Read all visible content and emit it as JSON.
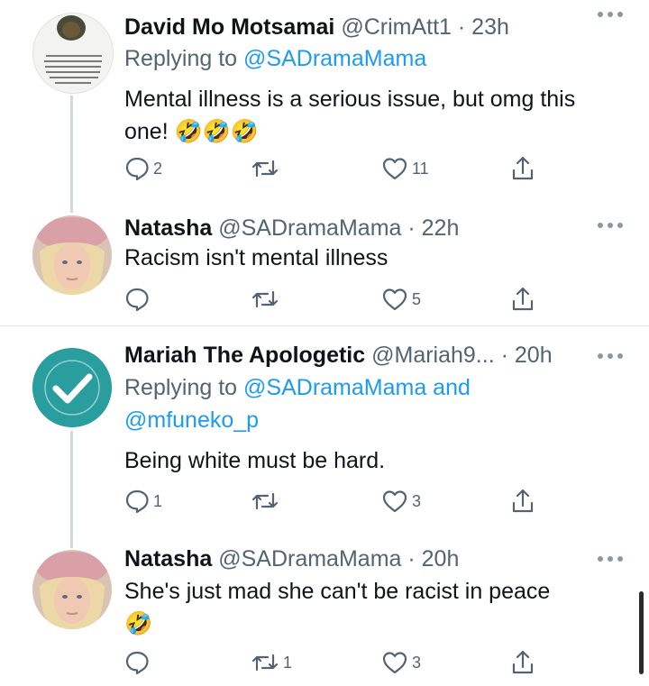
{
  "tweets": [
    {
      "name": "David Mo Motsamai",
      "handle": "@CrimAtt1",
      "dot": "·",
      "time": "23h",
      "reply_prefix": "Replying to ",
      "reply_to": "@SADramaMama",
      "reply_and": "",
      "reply_to2": "",
      "text": "Mental illness is a serious issue, but omg this one! 🤣🤣🤣",
      "reply_count": "2",
      "retweet_count": "",
      "like_count": "11",
      "avatar_quote": "\"If you are emotionally attached to your tribe, religion or political leaning to the point that truth and justice become secondary considerations, your education is useless. Your exposure is useless. If you cannot rise beyond petty sentiments, your liability to mankind.\" —Chinua Okadigbo"
    },
    {
      "name": "Natasha",
      "handle": "@SADramaMama",
      "dot": "·",
      "time": "22h",
      "text": "Racism isn't mental illness",
      "reply_count": "",
      "retweet_count": "",
      "like_count": "5"
    },
    {
      "name": "Mariah The Apologetic",
      "handle": "@Mariah9...",
      "dot": "·",
      "time": "20h",
      "reply_prefix": "Replying to ",
      "reply_to": "@SADramaMama",
      "reply_and": " and",
      "reply_to2": "@mfuneko_p",
      "text": "Being white must be hard.",
      "reply_count": "1",
      "retweet_count": "",
      "like_count": "3"
    },
    {
      "name": "Natasha",
      "handle": "@SADramaMama",
      "dot": "·",
      "time": "20h",
      "text": "She's just mad she can't be racist in peace",
      "text2": "🤣",
      "reply_count": "",
      "retweet_count": "1",
      "like_count": "3"
    }
  ],
  "icons": [
    "reply-icon",
    "retweet-icon",
    "like-icon",
    "share-icon",
    "more-icon",
    "checkmark-icon"
  ],
  "colors": {
    "text": "#0f1419",
    "secondary": "#536471",
    "link": "#1d9bf0",
    "thread_line": "#cfd9de",
    "checkmark_bg": "#2a9d9f"
  }
}
